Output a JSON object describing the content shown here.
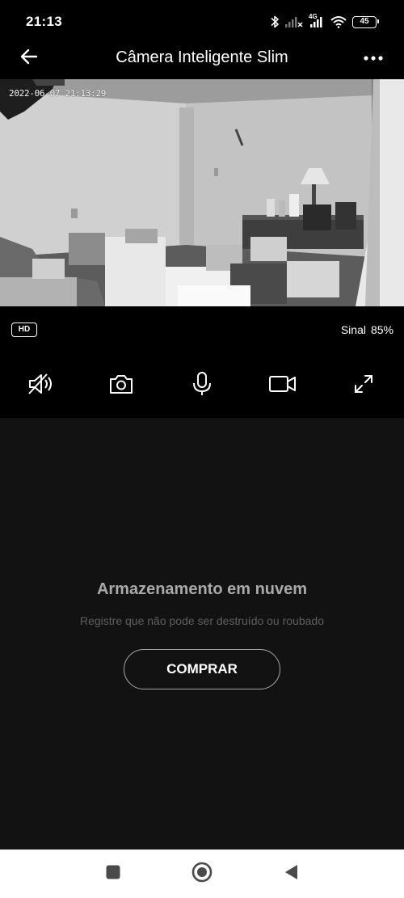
{
  "status_bar": {
    "time": "21:13",
    "network": "4G",
    "battery": "45",
    "icons": [
      "bluetooth-icon",
      "signal-nosim-icon",
      "signal-icon",
      "wifi-icon",
      "battery-icon"
    ]
  },
  "header": {
    "title": "Câmera Inteligente Slim",
    "back_icon": "arrow-left-icon",
    "more_icon": "more-horizontal-icon"
  },
  "video": {
    "timestamp": "2022-06-07 21:13:29"
  },
  "info": {
    "quality": "HD",
    "signal_label": "Sinal",
    "signal_value": "85%"
  },
  "controls": [
    {
      "name": "mute",
      "icon": "speaker-muted-icon"
    },
    {
      "name": "snapshot",
      "icon": "camera-icon"
    },
    {
      "name": "talk",
      "icon": "microphone-icon"
    },
    {
      "name": "record",
      "icon": "video-camera-icon"
    },
    {
      "name": "fullscreen",
      "icon": "expand-icon"
    }
  ],
  "cloud": {
    "title": "Armazenamento em nuvem",
    "subtitle": "Registre que não pode ser destruído ou roubado",
    "buy_label": "COMPRAR"
  },
  "nav": {
    "icons": [
      "recents-square-icon",
      "home-circle-icon",
      "back-triangle-icon"
    ]
  },
  "colors": {
    "background": "#000000",
    "content_bg": "#121212",
    "title_gray": "#a9a9a9",
    "subtitle_gray": "#5f5f5f",
    "nav_bg": "#ffffff"
  }
}
